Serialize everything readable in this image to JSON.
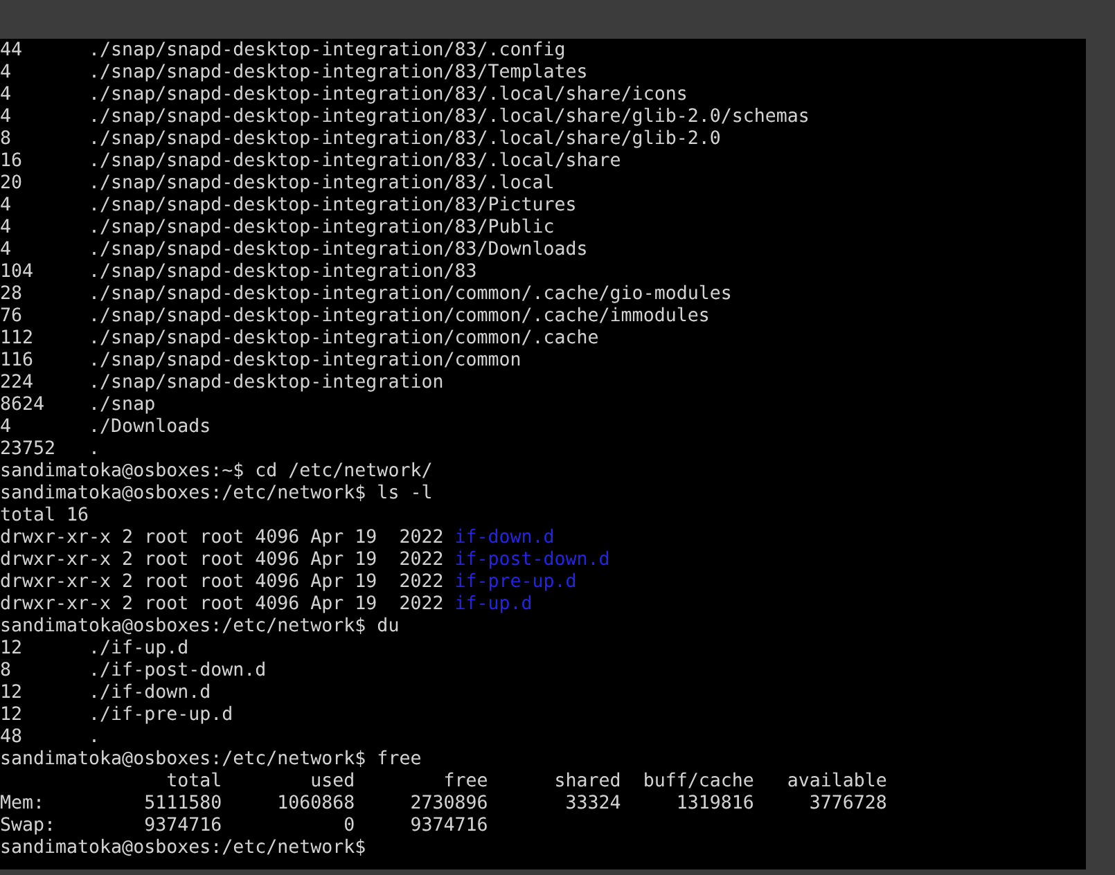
{
  "terminal": {
    "lines": [
      {
        "kind": "text",
        "text": "44      ./snap/snapd-desktop-integration/83/.config"
      },
      {
        "kind": "text",
        "text": "4       ./snap/snapd-desktop-integration/83/Templates"
      },
      {
        "kind": "text",
        "text": "4       ./snap/snapd-desktop-integration/83/.local/share/icons"
      },
      {
        "kind": "text",
        "text": "4       ./snap/snapd-desktop-integration/83/.local/share/glib-2.0/schemas"
      },
      {
        "kind": "text",
        "text": "8       ./snap/snapd-desktop-integration/83/.local/share/glib-2.0"
      },
      {
        "kind": "text",
        "text": "16      ./snap/snapd-desktop-integration/83/.local/share"
      },
      {
        "kind": "text",
        "text": "20      ./snap/snapd-desktop-integration/83/.local"
      },
      {
        "kind": "text",
        "text": "4       ./snap/snapd-desktop-integration/83/Pictures"
      },
      {
        "kind": "text",
        "text": "4       ./snap/snapd-desktop-integration/83/Public"
      },
      {
        "kind": "text",
        "text": "4       ./snap/snapd-desktop-integration/83/Downloads"
      },
      {
        "kind": "text",
        "text": "104     ./snap/snapd-desktop-integration/83"
      },
      {
        "kind": "text",
        "text": "28      ./snap/snapd-desktop-integration/common/.cache/gio-modules"
      },
      {
        "kind": "text",
        "text": "76      ./snap/snapd-desktop-integration/common/.cache/immodules"
      },
      {
        "kind": "text",
        "text": "112     ./snap/snapd-desktop-integration/common/.cache"
      },
      {
        "kind": "text",
        "text": "116     ./snap/snapd-desktop-integration/common"
      },
      {
        "kind": "text",
        "text": "224     ./snap/snapd-desktop-integration"
      },
      {
        "kind": "text",
        "text": "8624    ./snap"
      },
      {
        "kind": "text",
        "text": "4       ./Downloads"
      },
      {
        "kind": "text",
        "text": "23752   ."
      },
      {
        "kind": "text",
        "text": "sandimatoka@osboxes:~$ cd /etc/network/"
      },
      {
        "kind": "text",
        "text": "sandimatoka@osboxes:/etc/network$ ls -l"
      },
      {
        "kind": "text",
        "text": "total 16"
      },
      {
        "kind": "dir",
        "text": "drwxr-xr-x 2 root root 4096 Apr 19  2022",
        "name": "if-down.d"
      },
      {
        "kind": "dir",
        "text": "drwxr-xr-x 2 root root 4096 Apr 19  2022",
        "name": "if-post-down.d"
      },
      {
        "kind": "dir",
        "text": "drwxr-xr-x 2 root root 4096 Apr 19  2022",
        "name": "if-pre-up.d"
      },
      {
        "kind": "dir",
        "text": "drwxr-xr-x 2 root root 4096 Apr 19  2022",
        "name": "if-up.d"
      },
      {
        "kind": "text",
        "text": "sandimatoka@osboxes:/etc/network$ du"
      },
      {
        "kind": "text",
        "text": "12      ./if-up.d"
      },
      {
        "kind": "text",
        "text": "8       ./if-post-down.d"
      },
      {
        "kind": "text",
        "text": "12      ./if-down.d"
      },
      {
        "kind": "text",
        "text": "12      ./if-pre-up.d"
      },
      {
        "kind": "text",
        "text": "48      ."
      },
      {
        "kind": "text",
        "text": "sandimatoka@osboxes:/etc/network$ free"
      },
      {
        "kind": "text",
        "text": "               total        used        free      shared  buff/cache   available"
      },
      {
        "kind": "text",
        "text": "Mem:         5111580     1060868     2730896       33324     1319816     3776728"
      },
      {
        "kind": "text",
        "text": "Swap:        9374716           0     9374716"
      },
      {
        "kind": "text",
        "text": "sandimatoka@osboxes:/etc/network$"
      }
    ]
  }
}
